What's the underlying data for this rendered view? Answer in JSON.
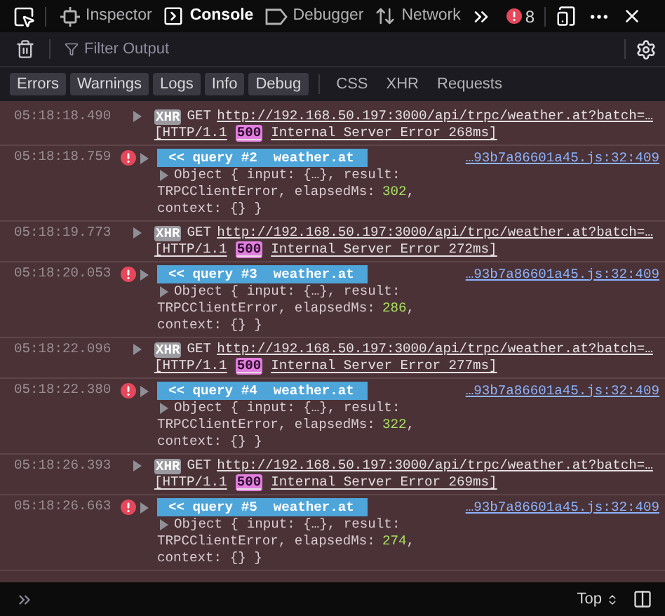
{
  "toolbar": {
    "tabs": [
      {
        "label": "Inspector",
        "selected": false
      },
      {
        "label": "Console",
        "selected": true
      },
      {
        "label": "Debugger",
        "selected": false
      },
      {
        "label": "Network",
        "selected": false
      }
    ],
    "error_count": "8"
  },
  "filter": {
    "placeholder": "Filter Output"
  },
  "filter_buttons": [
    {
      "label": "Errors",
      "selected": true
    },
    {
      "label": "Warnings",
      "selected": true
    },
    {
      "label": "Logs",
      "selected": true
    },
    {
      "label": "Info",
      "selected": true
    },
    {
      "label": "Debug",
      "selected": true
    },
    {
      "label": "CSS",
      "selected": false
    },
    {
      "label": "XHR",
      "selected": false
    },
    {
      "label": "Requests",
      "selected": false
    }
  ],
  "messages": [
    {
      "kind": "xhr",
      "time": "05:18:18.490",
      "tag": "XHR",
      "method": "GET",
      "url": "http://192.168.50.197:3000/api/trpc/weather.at?batch=…",
      "protocol": "[HTTP/1.1",
      "code": "500",
      "status": "Internal Server Error 268ms]"
    },
    {
      "kind": "error",
      "time": "05:18:18.759",
      "badge": "<< query #2  weather.at",
      "location": "…93b7a86601a45.js:32:409",
      "line_1": "Object { input: {…}, result:",
      "line_2": "TRPCClientError, elapsedMs:",
      "elapsed": "302",
      "line_2_end": ",",
      "line_3": "context: {} }"
    },
    {
      "kind": "xhr",
      "time": "05:18:19.773",
      "tag": "XHR",
      "method": "GET",
      "url": "http://192.168.50.197:3000/api/trpc/weather.at?batch=…",
      "protocol": "[HTTP/1.1",
      "code": "500",
      "status": "Internal Server Error 272ms]"
    },
    {
      "kind": "error",
      "time": "05:18:20.053",
      "badge": "<< query #3  weather.at",
      "location": "…93b7a86601a45.js:32:409",
      "line_1": "Object { input: {…}, result:",
      "line_2": "TRPCClientError, elapsedMs:",
      "elapsed": "286",
      "line_2_end": ",",
      "line_3": "context: {} }"
    },
    {
      "kind": "xhr",
      "time": "05:18:22.096",
      "tag": "XHR",
      "method": "GET",
      "url": "http://192.168.50.197:3000/api/trpc/weather.at?batch=…",
      "protocol": "[HTTP/1.1",
      "code": "500",
      "status": "Internal Server Error 277ms]"
    },
    {
      "kind": "error",
      "time": "05:18:22.380",
      "badge": "<< query #4  weather.at",
      "location": "…93b7a86601a45.js:32:409",
      "line_1": "Object { input: {…}, result:",
      "line_2": "TRPCClientError, elapsedMs:",
      "elapsed": "322",
      "line_2_end": ",",
      "line_3": "context: {} }"
    },
    {
      "kind": "xhr",
      "time": "05:18:26.393",
      "tag": "XHR",
      "method": "GET",
      "url": "http://192.168.50.197:3000/api/trpc/weather.at?batch=…",
      "protocol": "[HTTP/1.1",
      "code": "500",
      "status": "Internal Server Error 269ms]"
    },
    {
      "kind": "error",
      "time": "05:18:26.663",
      "badge": "<< query #5  weather.at",
      "location": "…93b7a86601a45.js:32:409",
      "line_1": "Object { input: {…}, result:",
      "line_2": "TRPCClientError, elapsedMs:",
      "elapsed": "274",
      "line_2_end": ",",
      "line_3": "context: {} }"
    }
  ],
  "bottom_bar": {
    "context": "Top"
  }
}
